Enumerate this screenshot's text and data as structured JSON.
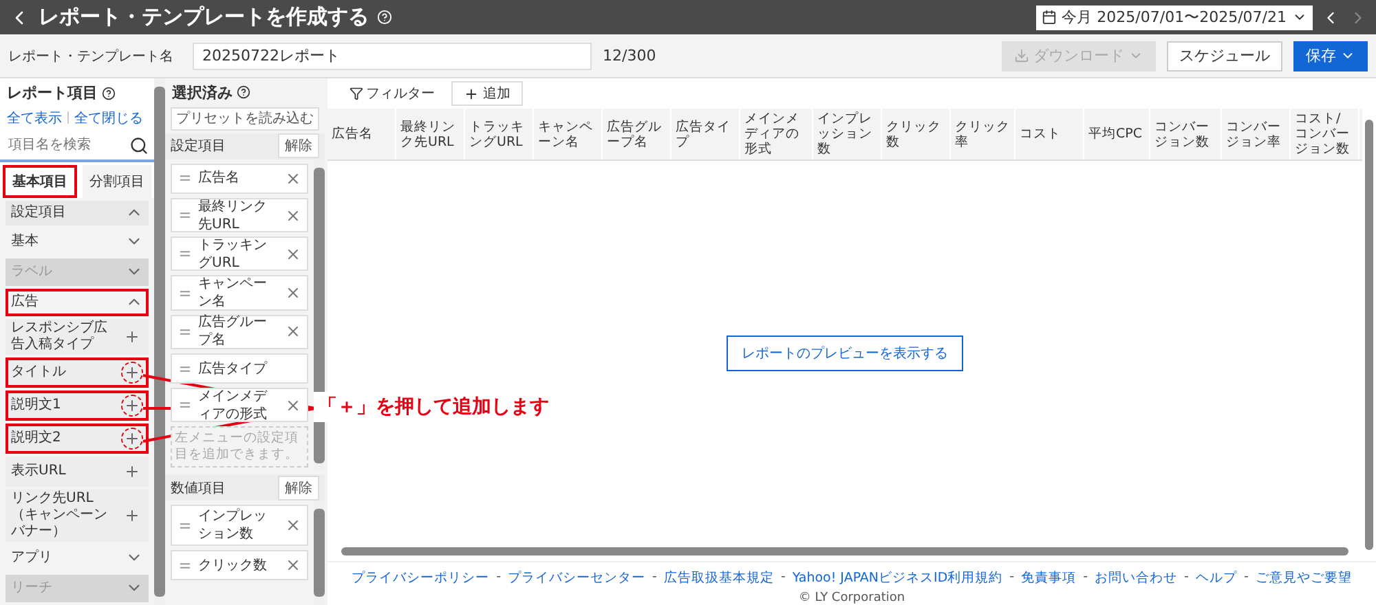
{
  "header": {
    "title": "レポート・テンプレートを作成する",
    "date_range": "今月 2025/07/01〜2025/07/21"
  },
  "template_bar": {
    "label": "レポート・テンプレート名",
    "value": "20250722レポート",
    "count": "12/300",
    "buttons": [
      {
        "label": "ダウンロード",
        "kind": "download",
        "disabled": true
      },
      {
        "label": "スケジュール",
        "kind": "plain",
        "disabled": false
      },
      {
        "label": "保存",
        "kind": "primary",
        "disabled": false
      }
    ]
  },
  "report_items": {
    "title": "レポート項目",
    "links": [
      "全て表示",
      "全て閉じる"
    ],
    "link_separator": "|",
    "search": {
      "placeholder": "項目名を検索"
    },
    "tabs": [
      {
        "label": "基本項目",
        "selected": true,
        "highlighted": true
      },
      {
        "label": "分割項目",
        "selected": false,
        "highlighted": false
      }
    ],
    "list": [
      {
        "kind": "section",
        "label": "設定項目",
        "expanded": true,
        "disabled": false,
        "highlighted": false
      },
      {
        "kind": "group",
        "label": "基本",
        "expanded": false,
        "disabled": false,
        "highlighted": false
      },
      {
        "kind": "group",
        "label": "ラベル",
        "expanded": false,
        "disabled": true,
        "highlighted": false
      },
      {
        "kind": "group",
        "label": "広告",
        "expanded": true,
        "disabled": false,
        "highlighted": true
      },
      {
        "kind": "item",
        "label": "レスポンシブ広告入稿タイプ",
        "disabled": false,
        "highlighted": false
      },
      {
        "kind": "item",
        "label": "タイトル",
        "disabled": false,
        "highlighted": true
      },
      {
        "kind": "item",
        "label": "説明文1",
        "disabled": false,
        "highlighted": true
      },
      {
        "kind": "item",
        "label": "説明文2",
        "disabled": false,
        "highlighted": true
      },
      {
        "kind": "item",
        "label": "表示URL",
        "disabled": false,
        "highlighted": false
      },
      {
        "kind": "item",
        "label": "リンク先URL（キャンペーンバナー）",
        "disabled": false,
        "highlighted": false
      },
      {
        "kind": "group",
        "label": "アプリ",
        "expanded": false,
        "disabled": false,
        "highlighted": false
      },
      {
        "kind": "group",
        "label": "リーチ",
        "expanded": false,
        "disabled": true,
        "highlighted": false
      }
    ]
  },
  "selected_panel": {
    "title": "選択済み",
    "preset_button": "プリセットを読み込む",
    "sections": [
      {
        "title": "設定項目",
        "clear_button": "解除",
        "hint": "左メニューの設定項目を追加できます。",
        "items": [
          {
            "label": "広告名",
            "removable": true
          },
          {
            "label": "最終リンク先URL",
            "removable": true
          },
          {
            "label": "トラッキングURL",
            "removable": true
          },
          {
            "label": "キャンペーン名",
            "removable": true
          },
          {
            "label": "広告グループ名",
            "removable": true
          },
          {
            "label": "広告タイプ",
            "removable": false
          },
          {
            "label": "メインメディアの形式",
            "removable": true
          }
        ]
      },
      {
        "title": "数値項目",
        "clear_button": "解除",
        "items": [
          {
            "label": "インプレッション数",
            "removable": true
          },
          {
            "label": "クリック数",
            "removable": true
          }
        ]
      }
    ]
  },
  "preview": {
    "filter": "フィルター",
    "add": "追加",
    "columns": [
      "広告名",
      "最終リンク先URL",
      "トラッキングURL",
      "キャンペーン名",
      "広告グループ名",
      "広告タイプ",
      "メインメディアの形式",
      "インプレッション数",
      "クリック数",
      "クリック率",
      "コスト",
      "平均CPC",
      "コンバージョン数",
      "コンバージョン率",
      "コスト/コンバージョン数"
    ],
    "preview_button": "レポートのプレビューを表示する"
  },
  "footer": {
    "separator": "-",
    "links": [
      "プライバシーポリシー",
      "プライバシーセンター",
      "広告取扱基本規定",
      "Yahoo! JAPANビジネスID利用規約",
      "免責事項",
      "お問い合わせ",
      "ヘルプ",
      "ご意見やご要望"
    ],
    "copyright": "© LY Corporation"
  },
  "annotation": {
    "text": "「＋」を押して追加します"
  }
}
